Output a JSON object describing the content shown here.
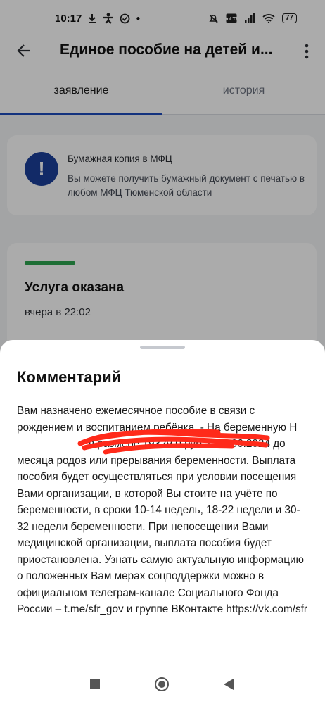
{
  "status_bar": {
    "time": "10:17",
    "battery": "77",
    "icons": [
      "download-icon",
      "person-icon",
      "check-circle-icon",
      "dot-icon",
      "mute-icon",
      "volte-icon",
      "signal-icon",
      "wifi-icon",
      "battery-icon"
    ]
  },
  "header": {
    "title": "Единое пособие на детей и..."
  },
  "tabs": [
    {
      "label": "заявление",
      "active": true
    },
    {
      "label": "история",
      "active": false
    }
  ],
  "info_card": {
    "title": "Бумажная копия в МФЦ",
    "text": "Вы можете получить бумажный документ с печатью в любом МФЦ Тюменской области",
    "icon": "!"
  },
  "status_card": {
    "title": "Услуга оказана",
    "time": "вчера в 22:02",
    "accent": "#2ea44f"
  },
  "sheet": {
    "title": "Комментарий",
    "text": "Вам назначено ежемесячное пособие в связи с рождением и воспитанием ребёнка. - На беременную Н                               в размере 19329.0 руб. с 01.06.2024 до месяца родов или прерывания беременности. Выплата пособия будет осуществляться при условии посещения Вами организации, в которой Вы стоите на учёте по беременности, в сроки 10-14 недель, 18-22 недели и 30-32 недели беременности. При непосещении Вами медицинской организации, выплата пособия будет приостановлена. Узнать самую актуальную информацию о положенных Вам мерах соцподдержки можно в официальном телеграм-канале Социального Фонда России – t.me/sfr_gov и группе ВКонтакте https://vk.com/sfr"
  },
  "colors": {
    "accent": "#1d4bbd",
    "info_icon": "#1b3f9a",
    "success": "#2ea44f",
    "redaction": "#ff2a1a"
  }
}
